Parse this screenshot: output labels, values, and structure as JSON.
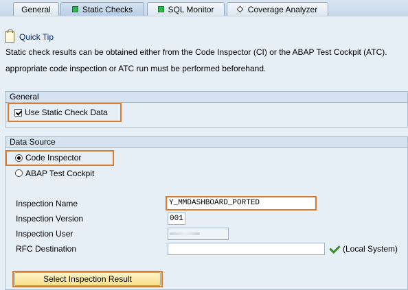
{
  "tabs": [
    {
      "label": "General",
      "icon": ""
    },
    {
      "label": "Static Checks",
      "icon": "green-square-icon"
    },
    {
      "label": "SQL Monitor",
      "icon": "green-square-icon"
    },
    {
      "label": "Coverage Analyzer",
      "icon": "diamond-icon"
    }
  ],
  "quick_tip": {
    "link": "Quick Tip",
    "line1": "Static check results can be obtained either from the Code Inspector (CI) or the ABAP Test Cockpit (ATC).",
    "line2": "appropriate code inspection or ATC run must be performed beforehand."
  },
  "general_group": {
    "title": "General",
    "use_static_check": {
      "label": "Use Static Check Data",
      "checked": true
    }
  },
  "data_source_group": {
    "title": "Data Source",
    "options": [
      {
        "label": "Code Inspector",
        "selected": true
      },
      {
        "label": "ABAP Test Cockpit",
        "selected": false
      }
    ],
    "fields": {
      "inspection_name": {
        "label": "Inspection Name",
        "value": "Y_MMDASHBOARD_PORTED"
      },
      "inspection_version": {
        "label": "Inspection Version",
        "value": "001"
      },
      "inspection_user": {
        "label": "Inspection User",
        "value": ""
      },
      "rfc_destination": {
        "label": "RFC Destination",
        "value": "",
        "status": "(Local System)"
      }
    },
    "select_button": "Select Inspection Result"
  },
  "colors": {
    "highlight": "#e07a2b",
    "panel_bg": "#e6eef6",
    "link": "#00297a"
  }
}
